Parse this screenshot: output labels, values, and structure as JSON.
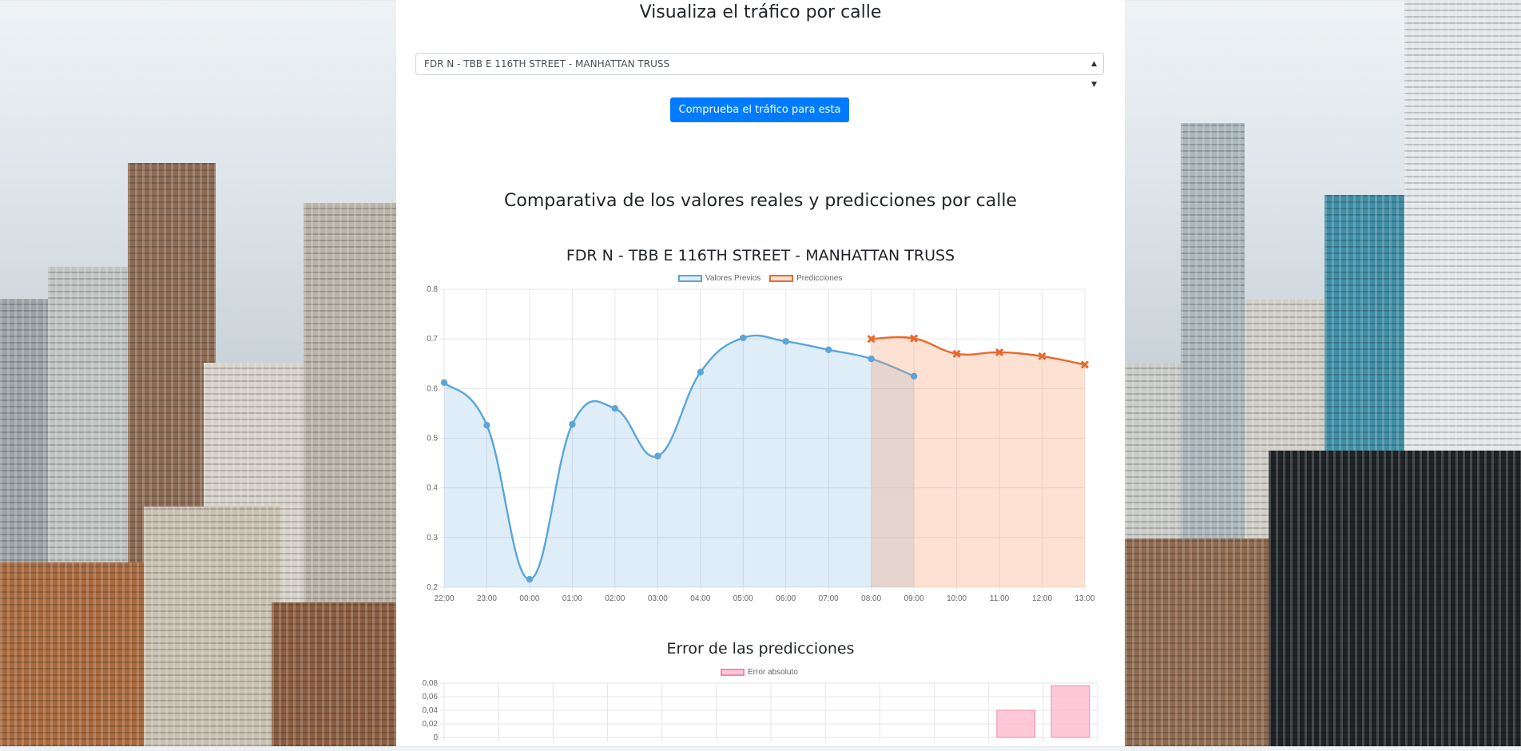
{
  "page": {
    "title": "Visualiza el tráfico por calle",
    "select": {
      "selected": "FDR N - TBB E 116TH STREET - MANHATTAN TRUSS"
    },
    "check_button": "Comprueba el tráfico para esta calle",
    "comparison_title": "Comparativa de los valores reales y predicciones por calle"
  },
  "colors": {
    "actual": "#5aa6d9",
    "actual_fill": "rgba(90,166,217,0.2)",
    "prediction": "#e8692e",
    "prediction_fill": "rgba(247,150,100,0.28)",
    "error": "#f08aa8",
    "error_fill": "rgba(255,182,203,0.75)",
    "button": "#007bff"
  },
  "chart_data": [
    {
      "type": "line",
      "title": "FDR N - TBB E 116TH STREET - MANHATTAN TRUSS",
      "x": [
        "22:00",
        "23:00",
        "00:00",
        "01:00",
        "02:00",
        "03:00",
        "04:00",
        "05:00",
        "06:00",
        "07:00",
        "08:00",
        "09:00",
        "10:00",
        "11:00",
        "12:00",
        "13:00"
      ],
      "series": [
        {
          "name": "Valores Previos",
          "marker": "circle",
          "fill": true,
          "values": [
            0.612,
            0.526,
            0.216,
            0.528,
            0.56,
            0.464,
            0.633,
            0.702,
            0.695,
            0.678,
            0.66,
            0.625,
            null,
            null,
            null,
            null
          ]
        },
        {
          "name": "Predicciones",
          "marker": "cross",
          "fill": true,
          "values": [
            null,
            null,
            null,
            null,
            null,
            null,
            null,
            null,
            null,
            null,
            0.7,
            0.701,
            0.67,
            0.673,
            0.665,
            0.648
          ]
        }
      ],
      "ylim": [
        0.2,
        0.8
      ],
      "yticks": [
        "0.8",
        "0.7",
        "0.6",
        "0.5",
        "0.4",
        "0.3",
        "0.2"
      ],
      "grid": true,
      "legend_position": "top"
    },
    {
      "type": "bar",
      "title": "Error de las predicciones",
      "series": [
        {
          "name": "Error absoluto",
          "values": [
            null,
            null,
            null,
            null,
            null,
            null,
            null,
            null,
            null,
            null,
            0.04,
            0.076
          ]
        }
      ],
      "ylim": [
        0,
        0.08
      ],
      "yticks": [
        "0,08",
        "0,06",
        "0,04",
        "0,02",
        "0"
      ],
      "grid": true,
      "legend_position": "top"
    }
  ]
}
